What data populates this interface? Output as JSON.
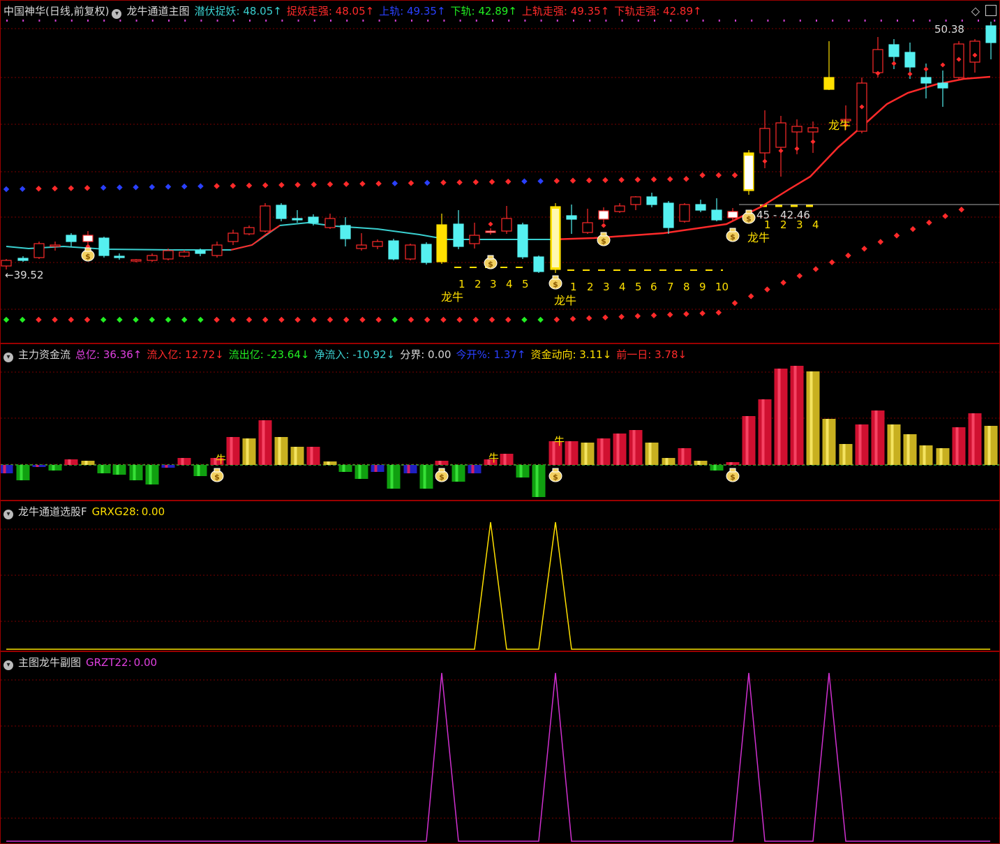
{
  "pane1": {
    "title": "中国神华(日线,前复权)",
    "indicator": "龙牛通道主图",
    "values": [
      {
        "label": "潜伏捉妖:",
        "value": "48.05",
        "arrow": "↑",
        "color": "#3ad0d0"
      },
      {
        "label": "捉妖走强:",
        "value": "48.05",
        "arrow": "↑",
        "color": "#ff2a2a"
      },
      {
        "label": "上轨:",
        "value": "49.35",
        "arrow": "↑",
        "color": "#2a40ff"
      },
      {
        "label": "下轨:",
        "value": "42.89",
        "arrow": "↑",
        "color": "#22ee22"
      },
      {
        "label": "上轨走强:",
        "value": "49.35",
        "arrow": "↑",
        "color": "#ff2a2a"
      },
      {
        "label": "下轨走强:",
        "value": "42.89",
        "arrow": "↑",
        "color": "#ff2a2a"
      }
    ],
    "high_label": "50.38",
    "low_label": "←39.52",
    "range_label": "45 - 42.46",
    "dragon_label": "龙牛",
    "count_labels_a": [
      "1",
      "2",
      "3",
      "4",
      "5"
    ],
    "count_labels_b": [
      "1",
      "2",
      "3",
      "4",
      "5",
      "6",
      "7",
      "8",
      "9",
      "10"
    ],
    "count_labels_c": [
      "1",
      "2",
      "3",
      "4"
    ]
  },
  "pane2": {
    "title": "主力资金流",
    "values": [
      {
        "label": "总亿:",
        "value": "36.36",
        "arrow": "↑",
        "color": "#e040e0"
      },
      {
        "label": "流入亿:",
        "value": "12.72",
        "arrow": "↓",
        "color": "#ff2a2a"
      },
      {
        "label": "流出亿:",
        "value": "-23.64",
        "arrow": "↓",
        "color": "#22ee22"
      },
      {
        "label": "净流入:",
        "value": "-10.92",
        "arrow": "↓",
        "color": "#3ad0d0"
      },
      {
        "label": "分界:",
        "value": "0.00",
        "arrow": "",
        "color": "#d8d8d8"
      },
      {
        "label": "今开%:",
        "value": "1.37",
        "arrow": "↑",
        "color": "#2a40ff"
      },
      {
        "label": "资金动向:",
        "value": "3.11",
        "arrow": "↓",
        "color": "#ffe000"
      },
      {
        "label": "前一日:",
        "value": "3.78",
        "arrow": "↓",
        "color": "#ff2a2a"
      }
    ],
    "niu_label": "牛"
  },
  "pane3": {
    "title": "龙牛通道选股F",
    "label": "GRXG28:",
    "value": "0.00",
    "color": "#ffe000"
  },
  "pane4": {
    "title": "主图龙牛副图",
    "label": "GRZT22:",
    "value": "0.00",
    "color": "#e040e0"
  },
  "icons": [
    "collapse-icon",
    "diamond-icon",
    "maximize-icon",
    "money-bag-icon"
  ]
}
